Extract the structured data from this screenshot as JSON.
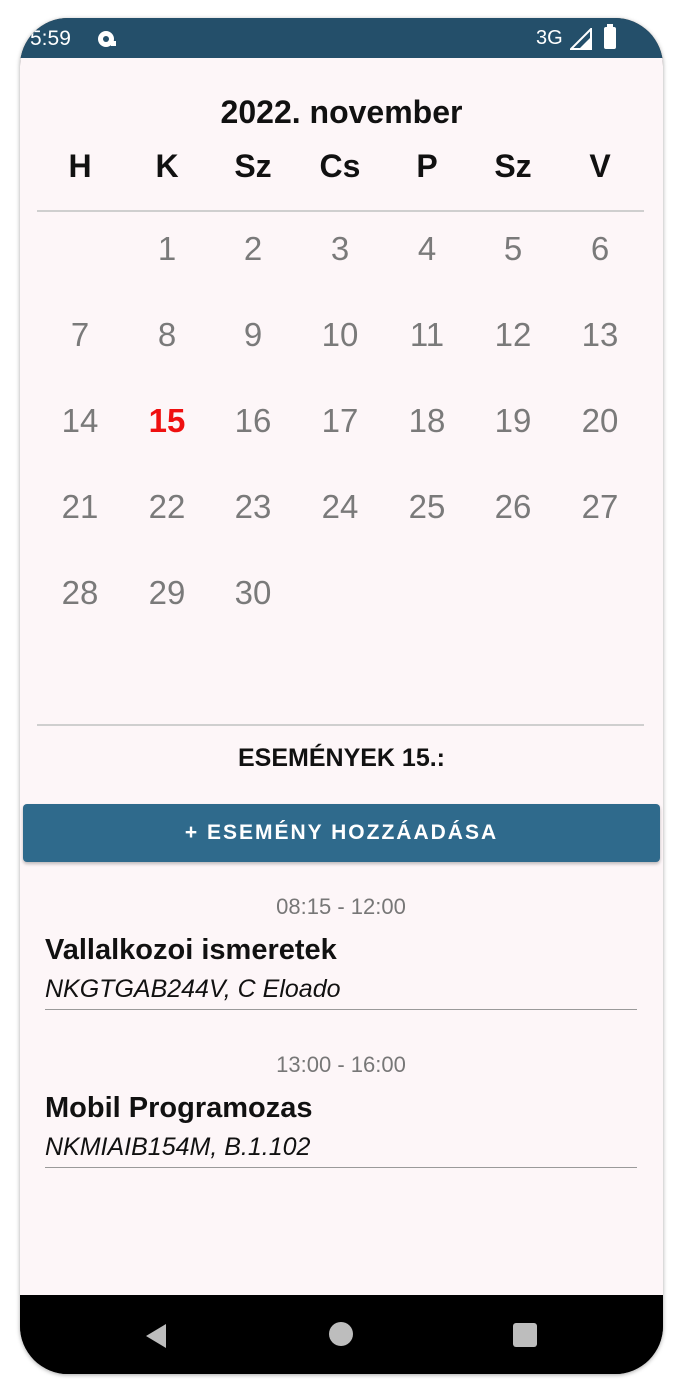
{
  "status_bar": {
    "time": "5:59",
    "network": "3G",
    "app_icon": "notification-app-icon",
    "signal_icon": "signal-icon",
    "battery_icon": "battery-icon",
    "background_color": "#244f6a"
  },
  "calendar": {
    "month_title": "2022. november",
    "weekdays": [
      "H",
      "K",
      "Sz",
      "Cs",
      "P",
      "Sz",
      "V"
    ],
    "weeks": [
      [
        "",
        "1",
        "2",
        "3",
        "4",
        "5",
        "6"
      ],
      [
        "7",
        "8",
        "9",
        "10",
        "11",
        "12",
        "13"
      ],
      [
        "14",
        "15",
        "16",
        "17",
        "18",
        "19",
        "20"
      ],
      [
        "21",
        "22",
        "23",
        "24",
        "25",
        "26",
        "27"
      ],
      [
        "28",
        "29",
        "30",
        "",
        "",
        "",
        ""
      ]
    ],
    "selected_day": "15",
    "selected_color": "#ef1010"
  },
  "events_section": {
    "heading": "ESEMÉNYEK 15.:",
    "add_button_label": "+ ESEMÉNY HOZZÁADÁSA",
    "button_color": "#2f6a8c",
    "events": [
      {
        "time": "08:15 - 12:00",
        "title": "Vallalkozoi ismeretek",
        "detail": "NKGTGAB244V, C Eloado"
      },
      {
        "time": "13:00 - 16:00",
        "title": "Mobil Programozas",
        "detail": "NKMIAIB154M, B.1.102"
      }
    ]
  },
  "nav_bar": {
    "back_icon": "back-triangle-icon",
    "home_icon": "home-circle-icon",
    "recents_icon": "recents-square-icon"
  }
}
